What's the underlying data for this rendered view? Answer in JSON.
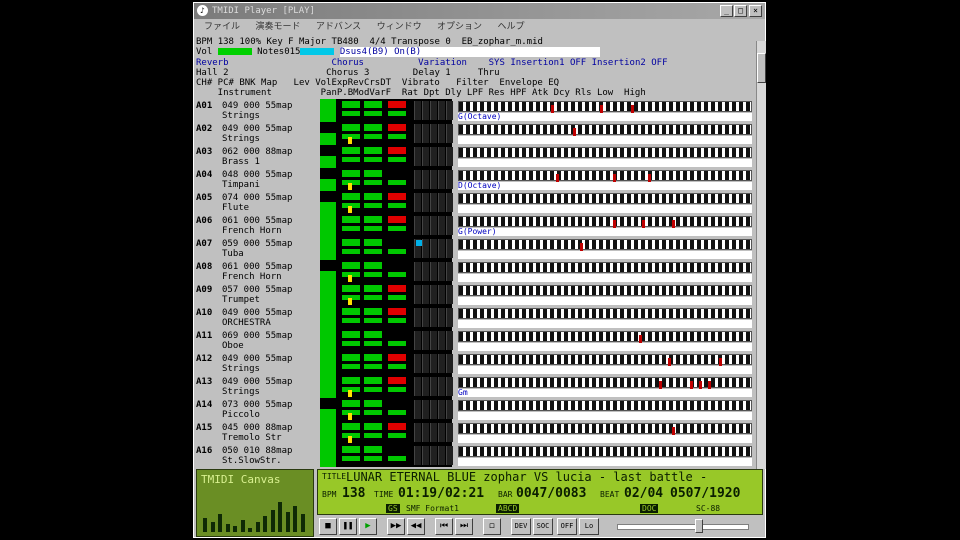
{
  "window": {
    "title": "TMIDI Player [PLAY]",
    "menu": [
      "ファイル",
      "演奏モード",
      "アドバンス",
      "ウィンドウ",
      "オプション",
      "ヘルプ"
    ],
    "minimize": "_",
    "maximize": "□",
    "close": "×"
  },
  "info": {
    "bpm_label": "BPM",
    "bpm": "138",
    "percent": "100%",
    "key_label": "Key",
    "key": "F Major",
    "timebase": "TB480",
    "meter": "4/4",
    "transpose_label": "Transpose",
    "transpose": "0",
    "filename": "EB_zophar_m.mid",
    "vol_label": "Vol",
    "notes_label": "Notes",
    "notes": "015",
    "chord": "Dsus4(B9) On(B)",
    "reverb_label": "Reverb",
    "reverb": "Hall 2",
    "chorus_label": "Chorus",
    "chorus": "Chorus 3",
    "variation_label": "Variation",
    "variation": "Delay 1",
    "sys_label": "SYS",
    "sys": "Thru",
    "insertion1_label": "Insertion1",
    "insertion1": "OFF",
    "insertion2_label": "Insertion2",
    "insertion2": "OFF",
    "header1": "CH# PC# BNK Map   Lev VolExpRevCrsDT  Vibrato   Filter  Envelope EQ",
    "header2": "    Instrument         PanP.BModVarF  Rat Dpt Dly LPF Res HPF Atk Dcy Rls Low  High"
  },
  "channels": [
    {
      "id": "A01",
      "info": "049 000 55map",
      "name": "Strings",
      "status": "G(Octave)"
    },
    {
      "id": "A02",
      "info": "049 000 55map",
      "name": "Strings",
      "status": ""
    },
    {
      "id": "A03",
      "info": "062 000 88map",
      "name": "Brass 1",
      "status": ""
    },
    {
      "id": "A04",
      "info": "048 000 55map",
      "name": "Timpani",
      "status": "D(Octave)"
    },
    {
      "id": "A05",
      "info": "074 000 55map",
      "name": "Flute",
      "status": ""
    },
    {
      "id": "A06",
      "info": "061 000 55map",
      "name": "French Horn",
      "status": "G(Power)"
    },
    {
      "id": "A07",
      "info": "059 000 55map",
      "name": "Tuba",
      "status": ""
    },
    {
      "id": "A08",
      "info": "061 000 55map",
      "name": "French Horn",
      "status": ""
    },
    {
      "id": "A09",
      "info": "057 000 55map",
      "name": "Trumpet",
      "status": ""
    },
    {
      "id": "A10",
      "info": "049 000 55map",
      "name": "ORCHESTRA",
      "status": ""
    },
    {
      "id": "A11",
      "info": "069 000 55map",
      "name": "Oboe",
      "status": ""
    },
    {
      "id": "A12",
      "info": "049 000 55map",
      "name": "Strings",
      "status": ""
    },
    {
      "id": "A13",
      "info": "049 000 55map",
      "name": "Strings",
      "status": "Gm"
    },
    {
      "id": "A14",
      "info": "073 000 55map",
      "name": "Piccolo",
      "status": ""
    },
    {
      "id": "A15",
      "info": "045 000 88map",
      "name": "Tremolo Str",
      "status": ""
    },
    {
      "id": "A16",
      "info": "050 010 88map",
      "name": "St.SlowStr.",
      "status": ""
    }
  ],
  "canvas": {
    "title": "TMIDI Canvas"
  },
  "lcd": {
    "title_label": "TITLE",
    "title": "LUNAR ETERNAL BLUE zophar VS lucia - last battle -",
    "bpm_label": "BPM",
    "bpm": "138",
    "time_label": "TIME",
    "time": "01:19/02:21",
    "bar_label": "BAR",
    "bar": "0047/0083",
    "beat_label": "BEAT",
    "beat": "02/04",
    "tick": "0507/1920",
    "gs": "GS",
    "format": "SMF Format1",
    "abcd": "ABCD",
    "doc": "DOC",
    "sc": "SC-88"
  },
  "controls": {
    "stop": "■",
    "pause": "❚❚",
    "play": "▶",
    "ffwd": "▶▶",
    "rew": "◀◀",
    "prev": "⏮",
    "next": "⏭",
    "rec": "◻",
    "mode1": "DEV",
    "mode2": "SOC",
    "mode3": "OFF",
    "loop": "Lo"
  }
}
